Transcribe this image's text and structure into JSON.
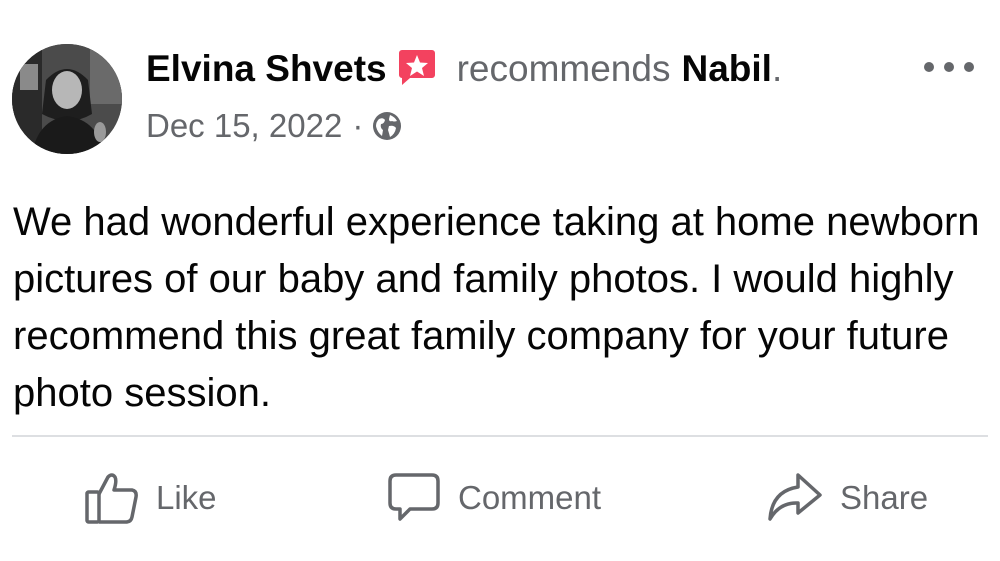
{
  "post": {
    "author": "Elvina Shvets",
    "recommends_text": "recommends",
    "page_name": "Nabil",
    "period": ".",
    "date": "Dec 15, 2022",
    "separator": "·",
    "privacy_icon": "globe-icon",
    "recommendation_icon": "recommendation-star-icon",
    "text": "We had wonderful experience taking at home newborn pictures of our baby and family photos. I would highly recommend this great family company for your future photo session."
  },
  "actions": {
    "like_label": "Like",
    "comment_label": "Comment",
    "share_label": "Share"
  },
  "colors": {
    "primary_text": "#050505",
    "secondary_text": "#65676b",
    "recommend_badge": "#f3425f",
    "divider": "#dddfe2"
  }
}
